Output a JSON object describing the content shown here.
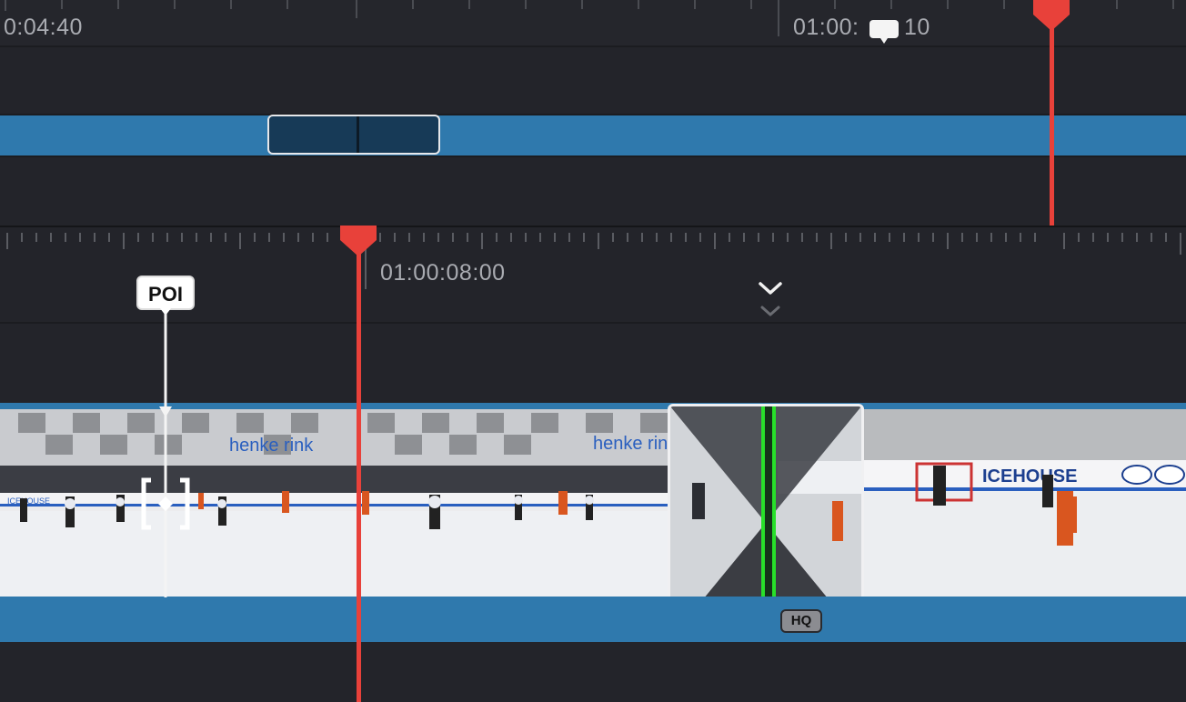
{
  "top_ruler": {
    "left_timecode": "0:04:40",
    "right_timecode": "01:00:",
    "right_timecode_suffix": "10"
  },
  "lower_ruler": {
    "timecode": "01:00:08:00"
  },
  "marker": {
    "label": "POI"
  },
  "transition": {
    "badge": "HQ"
  },
  "icons": {
    "marker_comment": "speech-bubble-icon",
    "chevron": "chevron-down-icon",
    "trim": "trim-bracket-icon"
  },
  "colors": {
    "background": "#23242a",
    "track_blue": "#2f79ad",
    "playhead": "#e8413a",
    "transition_green": "#28e02a"
  }
}
